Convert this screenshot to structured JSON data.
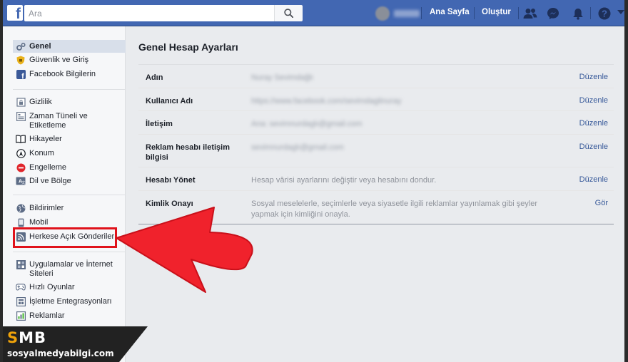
{
  "topbar": {
    "logo": "f",
    "search_placeholder": "Ara",
    "nav_home": "Ana Sayfa",
    "nav_create": "Oluştur"
  },
  "sidebar": {
    "groups": [
      [
        {
          "label": "Genel",
          "icon": "gear-icon",
          "active": true
        },
        {
          "label": "Güvenlik ve Giriş",
          "icon": "shield-icon"
        },
        {
          "label": "Facebook Bilgilerin",
          "icon": "facebook-icon"
        }
      ],
      [
        {
          "label": "Gizlilik",
          "icon": "lock-icon"
        },
        {
          "label": "Zaman Tüneli ve Etiketleme",
          "icon": "timeline-icon"
        },
        {
          "label": "Hikayeler",
          "icon": "book-icon"
        },
        {
          "label": "Konum",
          "icon": "location-icon"
        },
        {
          "label": "Engelleme",
          "icon": "block-icon"
        },
        {
          "label": "Dil ve Bölge",
          "icon": "language-icon"
        }
      ],
      [
        {
          "label": "Bildirimler",
          "icon": "globe-icon"
        },
        {
          "label": "Mobil",
          "icon": "mobile-icon"
        },
        {
          "label": "Herkese Açık Gönderiler",
          "icon": "rss-icon"
        }
      ],
      [
        {
          "label": "Uygulamalar ve İnternet Siteleri",
          "icon": "apps-icon"
        },
        {
          "label": "Hızlı Oyunlar",
          "icon": "gamepad-icon"
        },
        {
          "label": "İşletme Entegrasyonları",
          "icon": "business-icon"
        },
        {
          "label": "Reklamlar",
          "icon": "ads-icon"
        }
      ]
    ]
  },
  "main": {
    "title": "Genel Hesap Ayarları",
    "rows": [
      {
        "label": "Adın",
        "value": "Nuray Sevimdağlı",
        "action": "Düzenle",
        "blurred": true
      },
      {
        "label": "Kullanıcı Adı",
        "value": "https://www.facebook.com/sevimdaglinuray",
        "action": "Düzenle",
        "blurred": true
      },
      {
        "label": "İletişim",
        "value": "Ana: sevimnurdaglı@gmail.com",
        "action": "Düzenle",
        "blurred": true
      },
      {
        "label": "Reklam hesabı iletişim bilgisi",
        "value": "sevimnurdaglı@gmail.com",
        "action": "Düzenle",
        "blurred": true
      },
      {
        "label": "Hesabı Yönet",
        "value": "Hesap vârisi ayarlarını değiştir veya hesabını dondur.",
        "action": "Düzenle",
        "blurred": false
      },
      {
        "label": "Kimlik Onayı",
        "value": "Sosyal meselelerle, seçimlerle veya siyasetle ilgili reklamlar yayınlamak gibi şeyler yapmak için kimliğini onayla.",
        "action": "Gör",
        "blurred": false
      }
    ]
  },
  "watermark": {
    "logo_s": "S",
    "logo_mb": "MB",
    "url": "sosyalmedyabilgi.com"
  },
  "colors": {
    "brand": "#4267b2",
    "link": "#365899",
    "highlight": "#e0121b",
    "arrow": "#f0222c"
  }
}
